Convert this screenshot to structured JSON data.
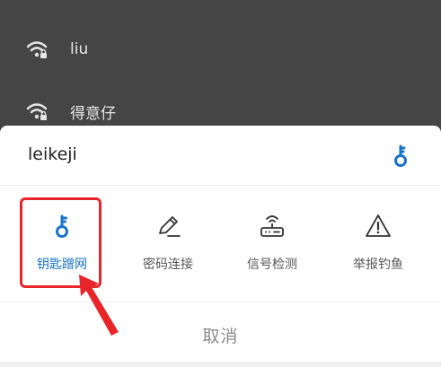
{
  "wifi_list": [
    {
      "name": "liu",
      "icon": "wifi-locked-icon"
    },
    {
      "name": "得意仔",
      "icon": "wifi-locked-icon"
    }
  ],
  "sheet": {
    "title": "leikeji",
    "header_icon": "key-icon",
    "actions": [
      {
        "label": "钥匙蹭网",
        "icon": "key-icon",
        "accent": "#1a73c8"
      },
      {
        "label": "密码连接",
        "icon": "pencil-icon"
      },
      {
        "label": "信号检测",
        "icon": "router-icon"
      },
      {
        "label": "举报钓鱼",
        "icon": "warning-icon"
      }
    ],
    "cancel_label": "取消"
  },
  "colors": {
    "accent": "#1a73c8",
    "highlight": "#e8262a",
    "overlay": "#454545"
  }
}
